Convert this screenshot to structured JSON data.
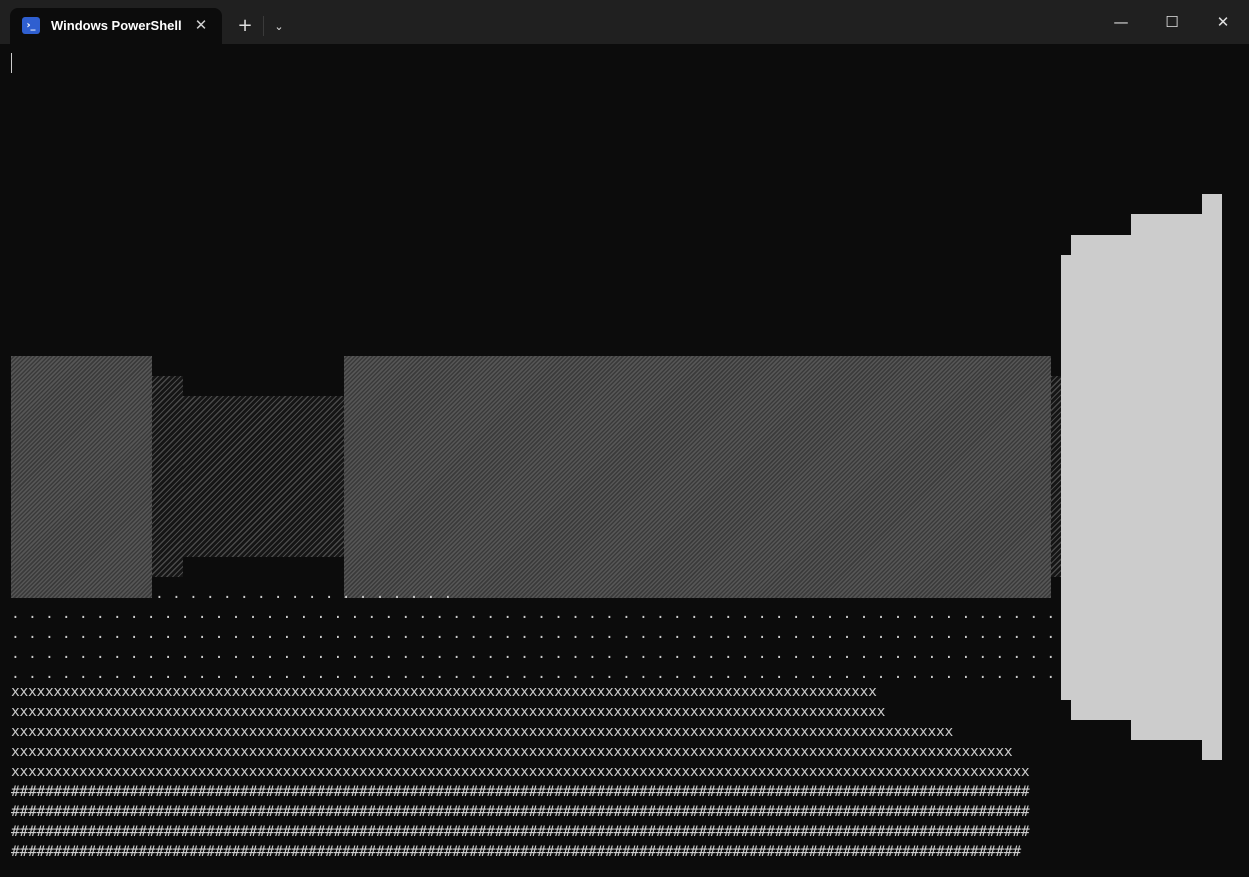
{
  "window": {
    "tab_title": "Windows PowerShell",
    "tab_icon": "powershell-icon",
    "icon_glyph": "›_",
    "close_tab_glyph": "✕",
    "new_tab_glyph": "+",
    "dropdown_glyph": "⌄",
    "minimize_glyph": "—",
    "maximize_glyph": "☐",
    "close_glyph": "✕"
  },
  "terminal": {
    "background": "#0c0c0c",
    "foreground": "#cccccc",
    "dot_row_short": ". . . . . . . . . . . . . . . . . .",
    "dot_rows": [
      ". . . . . . . . . . . . . . . . . . . . . . . . . . . . . . . . . . . . . . . . . . . . . . . . . . . . . . . . . . . . . . . . . . . . . . . . . . . . . . . . . . . . . . . . . . . . . . . . . . . . . . . . . . . . . . . . . . . . . . . . . . . . . . . . . . . . . . . . . . . . . . . . . .",
      ". . . . . . . . . . . . . . . . . . . . . . . . . . . . . . . . . . . . . . . . . . . . . . . . . . . . . . . . . . . . . . . . . . . . . . . . . . . . . . . . . . . . . . . . . . . . . . . . . . . . . . . . . . . . . . . . . . . . . . . . . . . . . . . . . . . . . . . . . . . . . . . . . .",
      ". . . . . . . . . . . . . . . . . . . . . . . . . . . . . . . . . . . . . . . . . . . . . . . . . . . . . . . . . . . . . . . . . . . . . . . . . . . . . . . . . . . . . . . . . . . . . . . . . . . . . . . . . . . . . . . . . . . . . . . . . . . . . . . . . . . . . . . . . . . . . . . . . .",
      ". . . . . . . . . . . . . . . . . . . . . . . . . . . . . . . . . . . . . . . . . . . . . . . . . . . . . . . . . . . . . . . . . . . . . . . . . . . . . . . . . . . . . . . . . . . . . . . . . . . . . . . . . . . . . . . . . . . . . . . . . . . . . . . . . . . . . . . . . . . . . . . . . ."
    ],
    "x_rows": [
      "xxxxxxxxxxxxxxxxxxxxxxxxxxxxxxxxxxxxxxxxxxxxxxxxxxxxxxxxxxxxxxxxxxxxxxxxxxxxxxxxxxxxxxxxxxxxxxxxxxxxxx",
      "xxxxxxxxxxxxxxxxxxxxxxxxxxxxxxxxxxxxxxxxxxxxxxxxxxxxxxxxxxxxxxxxxxxxxxxxxxxxxxxxxxxxxxxxxxxxxxxxxxxxxxx",
      "xxxxxxxxxxxxxxxxxxxxxxxxxxxxxxxxxxxxxxxxxxxxxxxxxxxxxxxxxxxxxxxxxxxxxxxxxxxxxxxxxxxxxxxxxxxxxxxxxxxxxxxxxxxxxxx",
      "xxxxxxxxxxxxxxxxxxxxxxxxxxxxxxxxxxxxxxxxxxxxxxxxxxxxxxxxxxxxxxxxxxxxxxxxxxxxxxxxxxxxxxxxxxxxxxxxxxxxxxxxxxxxxxxxxxxxxx",
      "xxxxxxxxxxxxxxxxxxxxxxxxxxxxxxxxxxxxxxxxxxxxxxxxxxxxxxxxxxxxxxxxxxxxxxxxxxxxxxxxxxxxxxxxxxxxxxxxxxxxxxxxxxxxxxxxxxxxxxxx"
    ],
    "hash_rows": [
      "########################################################################################################################",
      "########################################################################################################################",
      "########################################################################################################################",
      "#######################################################################################################################"
    ]
  }
}
